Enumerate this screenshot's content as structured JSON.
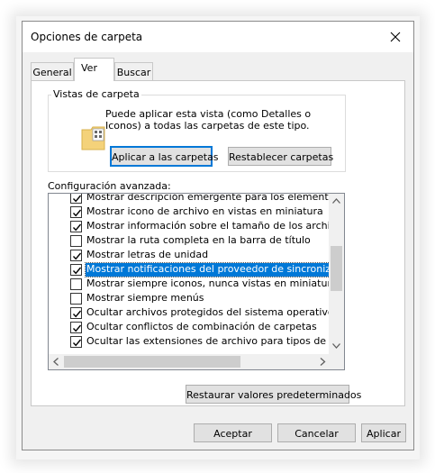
{
  "dialog": {
    "title": "Opciones de carpeta"
  },
  "tabs": [
    {
      "label": "General",
      "active": false
    },
    {
      "label": "Ver",
      "active": true
    },
    {
      "label": "Buscar",
      "active": false
    }
  ],
  "folder_views": {
    "group_label": "Vistas de carpeta",
    "description": "Puede aplicar esta vista (como Detalles o Iconos) a todas las carpetas de este tipo.",
    "apply_button": "Aplicar a las carpetas",
    "reset_button": "Restablecer carpetas"
  },
  "advanced": {
    "label": "Configuración avanzada:",
    "items": [
      {
        "text": "Mostrar descripción emergente para los elementos de car",
        "checked": true,
        "selected": false
      },
      {
        "text": "Mostrar icono de archivo en vistas en miniatura",
        "checked": true,
        "selected": false
      },
      {
        "text": "Mostrar información sobre el tamaño de los archivos en su",
        "checked": true,
        "selected": false
      },
      {
        "text": "Mostrar la ruta completa en la barra de título",
        "checked": false,
        "selected": false
      },
      {
        "text": "Mostrar letras de unidad",
        "checked": true,
        "selected": false
      },
      {
        "text": "Mostrar notificaciones del proveedor de sincronización",
        "checked": true,
        "selected": true
      },
      {
        "text": "Mostrar siempre iconos, nunca vistas en miniatura",
        "checked": false,
        "selected": false
      },
      {
        "text": "Mostrar siempre menús",
        "checked": false,
        "selected": false
      },
      {
        "text": "Ocultar archivos protegidos del sistema operativo (recome",
        "checked": true,
        "selected": false
      },
      {
        "text": "Ocultar conflictos de combinación de carpetas",
        "checked": true,
        "selected": false
      },
      {
        "text": "Ocultar las extensiones de archivo para tipos de archivo c",
        "checked": true,
        "selected": false
      }
    ],
    "restore_button": "Restaurar valores predeterminados"
  },
  "footer": {
    "ok": "Aceptar",
    "cancel": "Cancelar",
    "apply": "Aplicar"
  },
  "colors": {
    "selection": "#0078d7",
    "window_bg": "#f0f0f0",
    "folder_yellow": "#f4d27a"
  }
}
